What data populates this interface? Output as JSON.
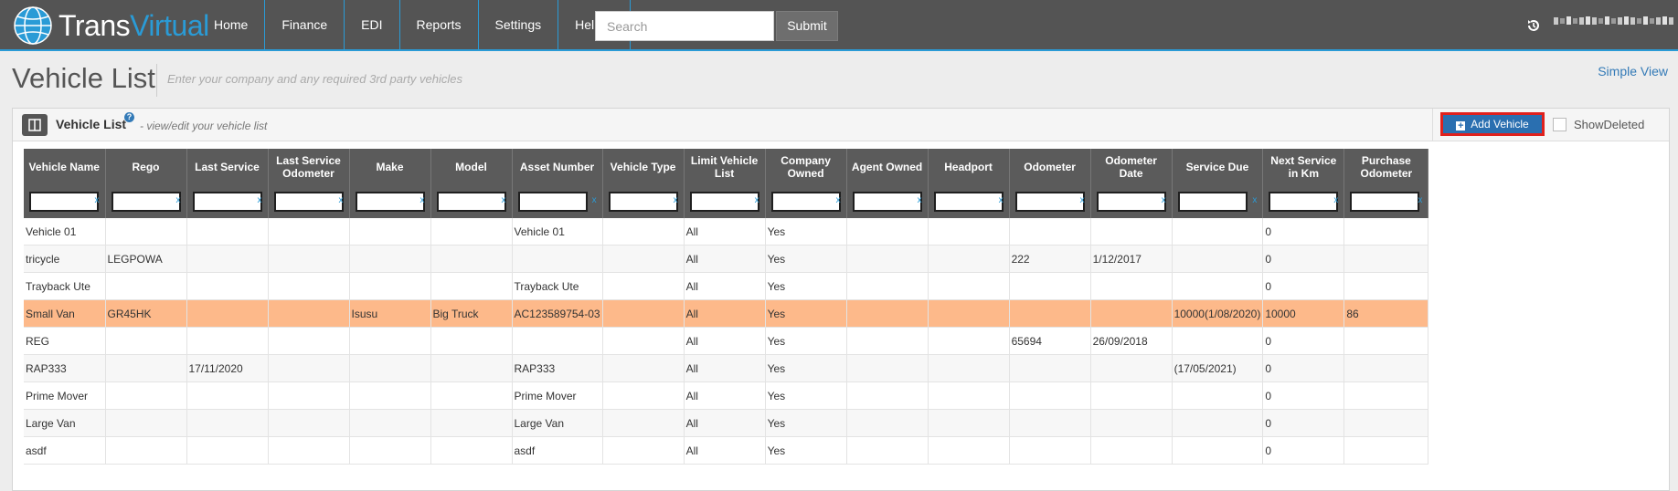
{
  "app": {
    "brand_part1": "Trans",
    "brand_part2": "Virtual"
  },
  "nav": {
    "items": [
      "Home",
      "Finance",
      "EDI",
      "Reports",
      "Settings",
      "Help"
    ]
  },
  "search": {
    "placeholder": "Search",
    "submit_label": "Submit"
  },
  "page": {
    "title": "Vehicle List",
    "subtitle": "Enter your company and any required 3rd party vehicles",
    "simple_view": "Simple View"
  },
  "panel": {
    "title": "Vehicle List",
    "help": "?",
    "description": "- view/edit your vehicle list",
    "add_label": "Add Vehicle",
    "show_deleted_label": "ShowDeleted"
  },
  "grid": {
    "filter_clear": "x",
    "columns": [
      "Vehicle Name",
      "Rego",
      "Last Service",
      "Last Service Odometer",
      "Make",
      "Model",
      "Asset Number",
      "Vehicle Type",
      "Limit Vehicle List",
      "Company Owned",
      "Agent Owned",
      "Headport",
      "Odometer",
      "Odometer Date",
      "Service Due",
      "Next Service in Km",
      "Purchase Odometer"
    ],
    "rows": [
      [
        "Vehicle 01",
        "",
        "",
        "",
        "",
        "",
        "Vehicle 01",
        "",
        "All",
        "Yes",
        "",
        "",
        "",
        "",
        "",
        "0",
        ""
      ],
      [
        "tricycle",
        "LEGPOWA",
        "",
        "",
        "",
        "",
        "",
        "",
        "All",
        "Yes",
        "",
        "",
        "222",
        "1/12/2017",
        "",
        "0",
        ""
      ],
      [
        "Trayback Ute",
        "",
        "",
        "",
        "",
        "",
        "Trayback Ute",
        "",
        "All",
        "Yes",
        "",
        "",
        "",
        "",
        "",
        "0",
        ""
      ],
      [
        "Small Van",
        "GR45HK",
        "",
        "",
        "Isusu",
        "Big Truck",
        "AC123589754-03",
        "",
        "All",
        "Yes",
        "",
        "",
        "",
        "",
        "10000(1/08/2020)",
        "10000",
        "86"
      ],
      [
        "REG",
        "",
        "",
        "",
        "",
        "",
        "",
        "",
        "All",
        "Yes",
        "",
        "",
        "65694",
        "26/09/2018",
        "",
        "0",
        ""
      ],
      [
        "RAP333",
        "",
        "17/11/2020",
        "",
        "",
        "",
        "RAP333",
        "",
        "All",
        "Yes",
        "",
        "",
        "",
        "",
        "(17/05/2021)",
        "0",
        ""
      ],
      [
        "Prime Mover",
        "",
        "",
        "",
        "",
        "",
        "Prime Mover",
        "",
        "All",
        "Yes",
        "",
        "",
        "",
        "",
        "",
        "0",
        ""
      ],
      [
        "Large Van",
        "",
        "",
        "",
        "",
        "",
        "Large Van",
        "",
        "All",
        "Yes",
        "",
        "",
        "",
        "",
        "",
        "0",
        ""
      ],
      [
        "asdf",
        "",
        "",
        "",
        "",
        "",
        "asdf",
        "",
        "All",
        "Yes",
        "",
        "",
        "",
        "",
        "",
        "0",
        ""
      ]
    ]
  },
  "colors": {
    "nav_bg": "#545454",
    "accent": "#2a9bd6",
    "header_bg": "#5b5b5b",
    "highlight_row": "#fdb98a",
    "add_button": "#2a6fb0",
    "add_button_outline": "#e0201c"
  },
  "icons": [
    "globe-logo-icon",
    "history-icon",
    "columns-icon",
    "help-icon",
    "plus-square-icon"
  ]
}
